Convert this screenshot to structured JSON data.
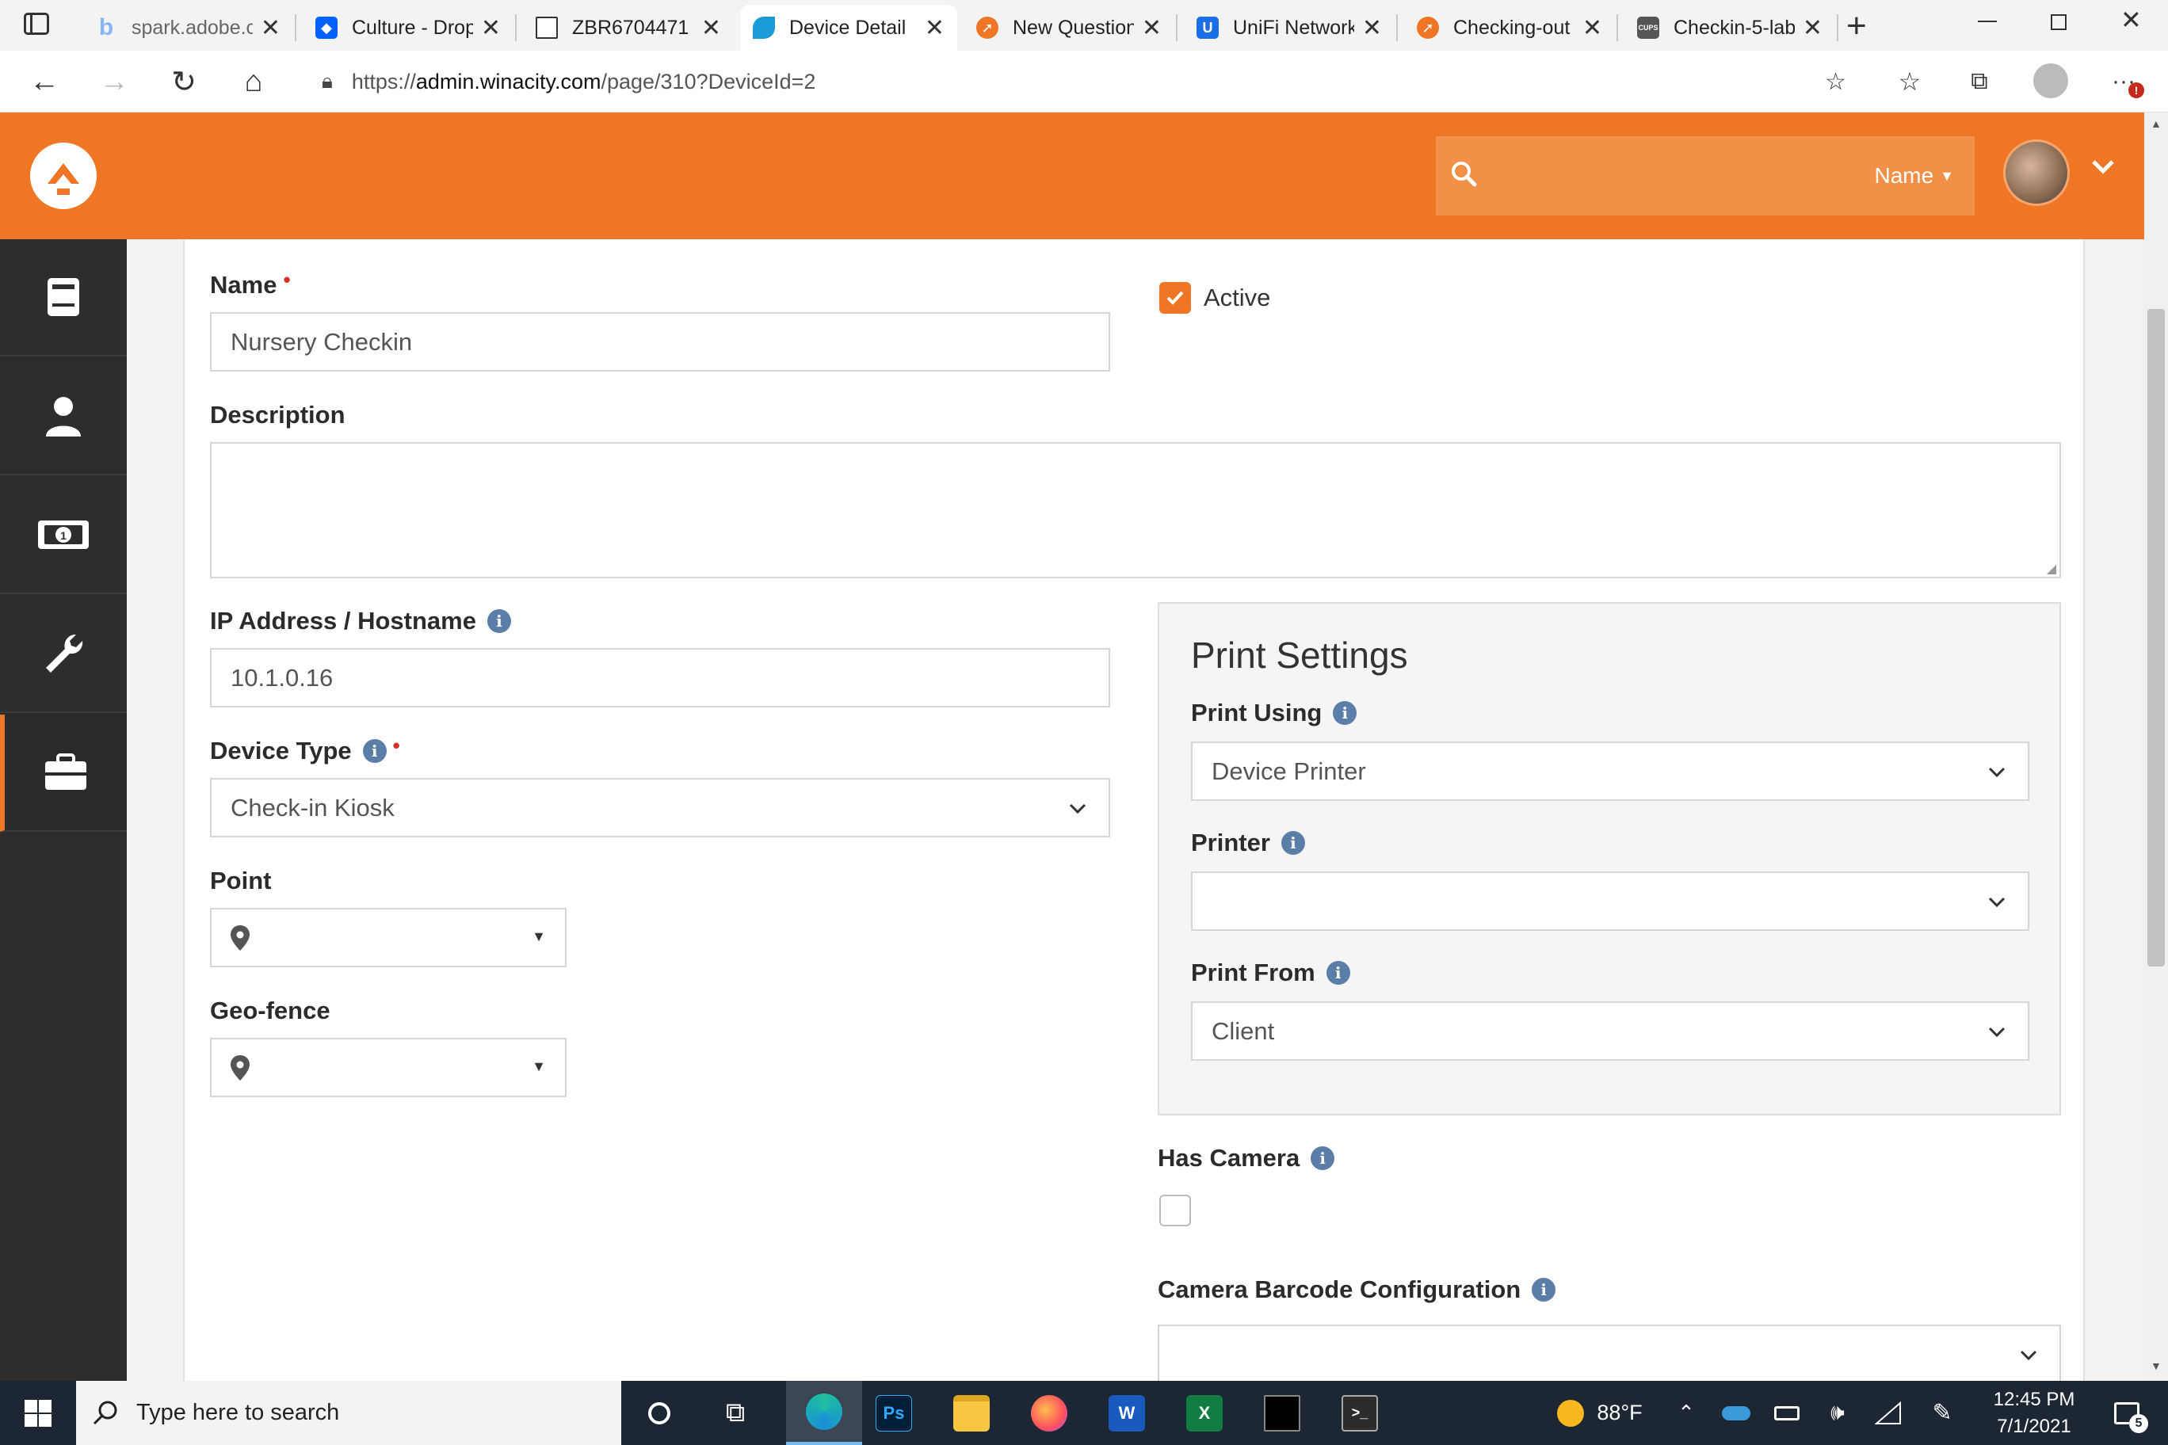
{
  "browser": {
    "tabs": [
      {
        "title": "spark.adobe.c",
        "favicon": "bing-b",
        "color": "#8ab4f8",
        "active": false
      },
      {
        "title": "Culture - Drop",
        "favicon": "dropbox",
        "color": "#0061fe",
        "active": false
      },
      {
        "title": "ZBR6704471 -",
        "favicon": "document",
        "color": "#ffffff",
        "active": false
      },
      {
        "title": "Device Detail",
        "favicon": "rock-leaf",
        "color": "#1a9bd7",
        "active": true
      },
      {
        "title": "New Question",
        "favicon": "rock-logo",
        "color": "#ee7624",
        "active": false
      },
      {
        "title": "UniFi Network",
        "favicon": "unifi-u",
        "color": "#1b6ee6",
        "active": false
      },
      {
        "title": "Checking-out",
        "favicon": "rock-logo",
        "color": "#ee7624",
        "active": false
      },
      {
        "title": "Checkin-5-lab",
        "favicon": "cups",
        "color": "#555555",
        "active": false
      }
    ],
    "url_prefix": "https://",
    "url_host": "admin.winacity.com",
    "url_path": "/page/310?DeviceId=2"
  },
  "header": {
    "search_placeholder": "",
    "search_scope": "Name"
  },
  "sidebar": {
    "items": [
      {
        "icon": "book-icon",
        "active": false
      },
      {
        "icon": "person-icon",
        "active": false
      },
      {
        "icon": "money-icon",
        "active": false
      },
      {
        "icon": "wrench-icon",
        "active": false
      },
      {
        "icon": "briefcase-icon",
        "active": true
      }
    ]
  },
  "form": {
    "name": {
      "label": "Name",
      "required": "•",
      "value": "Nursery Checkin"
    },
    "active": {
      "label": "Active",
      "checked": true
    },
    "description": {
      "label": "Description",
      "value": ""
    },
    "ip": {
      "label": "IP Address / Hostname",
      "value": "10.1.0.16"
    },
    "device_type": {
      "label": "Device Type",
      "required": "•",
      "value": "Check-in Kiosk"
    },
    "point": {
      "label": "Point"
    },
    "geofence": {
      "label": "Geo-fence"
    },
    "print_settings": {
      "title": "Print Settings",
      "print_using": {
        "label": "Print Using",
        "value": "Device Printer"
      },
      "printer": {
        "label": "Printer",
        "value": ""
      },
      "print_from": {
        "label": "Print From",
        "value": "Client"
      }
    },
    "has_camera": {
      "label": "Has Camera",
      "checked": false
    },
    "camera_barcode": {
      "label": "Camera Barcode Configuration",
      "value": ""
    }
  },
  "taskbar": {
    "search_placeholder": "Type here to search",
    "weather": "88°F",
    "time": "12:45 PM",
    "date": "7/1/2021",
    "notifications": "5",
    "colors": {
      "accent": "#ee7624",
      "taskbar": "#1d2733"
    }
  }
}
